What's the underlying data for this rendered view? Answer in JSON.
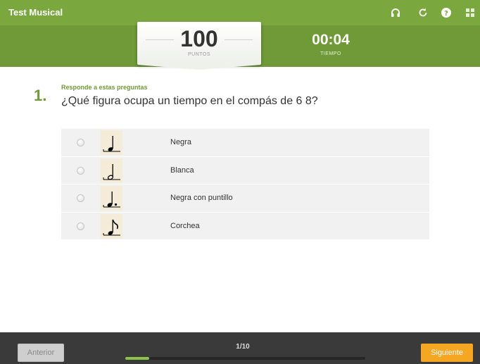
{
  "app": {
    "title": "Test Musical"
  },
  "toolbar": {
    "icons": [
      "headphones-icon",
      "reload-icon",
      "help-icon",
      "grid-icon"
    ]
  },
  "score": {
    "value": "100",
    "label": "PUNTOS"
  },
  "timer": {
    "value": "00:04",
    "label": "TIEMPO"
  },
  "question": {
    "number": "1.",
    "instruction": "Responde a estas preguntas",
    "text": "¿Qué figura ocupa un tiempo en el compás de 6 8?"
  },
  "options": [
    {
      "label": "Negra",
      "icon": "quarter-note-icon"
    },
    {
      "label": "Blanca",
      "icon": "half-note-icon"
    },
    {
      "label": "Negra con puntillo",
      "icon": "dotted-quarter-note-icon"
    },
    {
      "label": "Corchea",
      "icon": "eighth-note-icon"
    }
  ],
  "footer": {
    "prev_label": "Anterior",
    "next_label": "Siguiente",
    "page": "1/10",
    "progress": 0.1
  },
  "colors": {
    "header": "#6f9a37",
    "next_button": "#f5a623",
    "progress": "#8bc34a"
  }
}
